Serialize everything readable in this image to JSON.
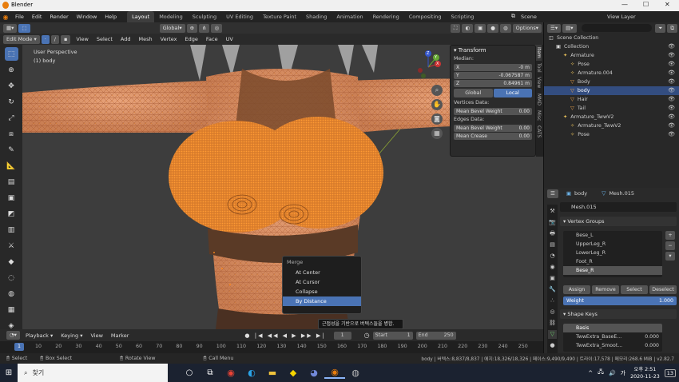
{
  "title_bar": {
    "app_title": "Blender",
    "controls": [
      "—",
      "☐",
      "✕"
    ]
  },
  "top_menu": [
    "File",
    "Edit",
    "Render",
    "Window",
    "Help"
  ],
  "workspaces": [
    "Layout",
    "Modeling",
    "Sculpting",
    "UV Editing",
    "Texture Paint",
    "Shading",
    "Animation",
    "Rendering",
    "Compositing",
    "Scripting"
  ],
  "scene": {
    "label": "Scene",
    "view_layer": "View Layer"
  },
  "viewport_header": {
    "mode": "Edit Mode",
    "menus": [
      "View",
      "Select",
      "Add",
      "Mesh",
      "Vertex",
      "Edge",
      "Face",
      "UV"
    ],
    "orientation": "Global",
    "options": "Options"
  },
  "viewport": {
    "perspective": "User Perspective",
    "object": "(1) body"
  },
  "gizmo": {
    "x": "X",
    "y": "Y",
    "z": "Z"
  },
  "transform_panel": {
    "title": "Transform",
    "median_label": "Median:",
    "x_label": "X",
    "x_value": "-0 m",
    "y_label": "Y",
    "y_value": "-0.067587 m",
    "z_label": "Z",
    "z_value": "0.84961 m",
    "global": "Global",
    "local": "Local",
    "vertices_data": "Vertices Data:",
    "mean_bevel_weight_label": "Mean Bevel Weight",
    "mean_bevel_weight_value": "0.00",
    "edges_data": "Edges Data:",
    "edge_bevel_label": "Mean Bevel Weight",
    "edge_bevel_value": "0.00",
    "mean_crease_label": "Mean Crease",
    "mean_crease_value": "0.00"
  },
  "n_tabs": [
    "Item",
    "Tool",
    "View",
    "MMD",
    "Misc",
    "CATS"
  ],
  "outliner": {
    "rows": [
      {
        "label": "Scene Collection",
        "indent": 0,
        "icon": "◫"
      },
      {
        "label": "Collection",
        "indent": 1,
        "icon": "▣"
      },
      {
        "label": "Armature",
        "indent": 2,
        "icon": "✦"
      },
      {
        "label": "Pose",
        "indent": 3,
        "icon": "✧"
      },
      {
        "label": "Armature.004",
        "indent": 3,
        "icon": "✧"
      },
      {
        "label": "Body",
        "indent": 3,
        "icon": "▽"
      },
      {
        "label": "body",
        "indent": 3,
        "icon": "▽",
        "selected": true
      },
      {
        "label": "Hair",
        "indent": 3,
        "icon": "▽"
      },
      {
        "label": "Tail",
        "indent": 3,
        "icon": "▽"
      },
      {
        "label": "Armature_TwwV2",
        "indent": 2,
        "icon": "✦"
      },
      {
        "label": "Armature_TwwV2",
        "indent": 3,
        "icon": "✧"
      },
      {
        "label": "Pose",
        "indent": 3,
        "icon": "✧"
      }
    ]
  },
  "properties": {
    "object_name": "body",
    "mesh_name": "Mesh.015",
    "mesh_field": "Mesh.015",
    "vertex_groups_title": "Vertex Groups",
    "vertex_groups": [
      "Bese_L",
      "UpperLeg_R",
      "LowerLeg_R",
      "Foot_R",
      "Bese_R"
    ],
    "assign": "Assign",
    "remove": "Remove",
    "select": "Select",
    "deselect": "Deselect",
    "weight_label": "Weight",
    "weight_value": "1.000",
    "shape_keys_title": "Shape Keys",
    "shape_keys": [
      {
        "name": "Basis",
        "value": ""
      },
      {
        "name": "TwwExtra_BaseE...",
        "value": "0.000"
      },
      {
        "name": "TwwExtra_Smoot...",
        "value": "0.000"
      }
    ]
  },
  "context_menu": {
    "title": "Merge",
    "items": [
      "At Center",
      "At Cursor",
      "Collapse",
      "By Distance"
    ],
    "highlighted": 3
  },
  "tooltip": "근접성을 기반으로 버텍스들을 병합.",
  "timeline": {
    "menus": [
      "Playback",
      "Keying",
      "View",
      "Marker"
    ],
    "start_label": "Start",
    "start_value": "1",
    "end_label": "End",
    "end_value": "250",
    "current_frame": "1",
    "frame_ticks": [
      "10",
      "20",
      "30",
      "40",
      "50",
      "60",
      "70",
      "80",
      "90",
      "100",
      "110",
      "120",
      "130",
      "140",
      "150",
      "160",
      "170",
      "180",
      "190",
      "200",
      "210",
      "220",
      "230",
      "240",
      "250"
    ]
  },
  "status_bar": {
    "select": "Select",
    "box_select": "Box Select",
    "rotate_view": "Rotate View",
    "call_menu": "Call Menu",
    "stats": "body | 버텍스:8,837/8,837 | 에지:18,326/18,326 | 페이스:9,490/9,490 | 트라이:17,578 | 메모리:268.6 MiB | v2.82.7"
  },
  "taskbar": {
    "search_placeholder": "찾기",
    "time": "오후 2:51",
    "date": "2020-11-23",
    "lang": "가",
    "notif": "13"
  },
  "colors": {
    "accent": "#4a73b4",
    "mesh": "#e8822c",
    "selection": "#334d80"
  }
}
